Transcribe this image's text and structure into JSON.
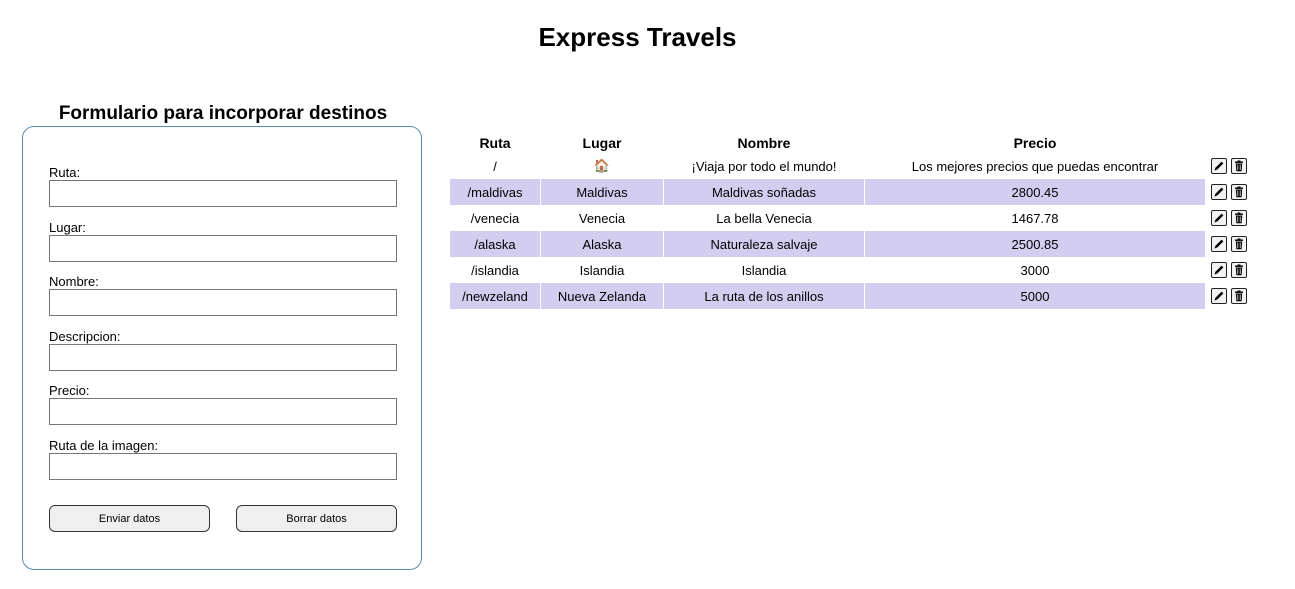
{
  "header": {
    "title": "Express Travels"
  },
  "form": {
    "title": "Formulario para incorporar destinos",
    "fields": [
      {
        "label": "Ruta:",
        "value": ""
      },
      {
        "label": "Lugar:",
        "value": ""
      },
      {
        "label": "Nombre:",
        "value": ""
      },
      {
        "label": "Descripcion:",
        "value": ""
      },
      {
        "label": "Precio:",
        "value": ""
      },
      {
        "label": "Ruta de la imagen:",
        "value": ""
      }
    ],
    "send_label": "Enviar datos",
    "clear_label": "Borrar datos"
  },
  "table": {
    "headers": [
      "Ruta",
      "Lugar",
      "Nombre",
      "Precio"
    ],
    "rows": [
      {
        "ruta": "/",
        "lugar": "🏠",
        "nombre": "¡Viaja por todo el mundo!",
        "precio": "Los mejores precios que puedas encontrar"
      },
      {
        "ruta": "/maldivas",
        "lugar": "Maldivas",
        "nombre": "Maldivas soñadas",
        "precio": "2800.45"
      },
      {
        "ruta": "/venecia",
        "lugar": "Venecia",
        "nombre": "La bella Venecia",
        "precio": "1467.78"
      },
      {
        "ruta": "/alaska",
        "lugar": "Alaska",
        "nombre": "Naturaleza salvaje",
        "precio": "2500.85"
      },
      {
        "ruta": "/islandia",
        "lugar": "Islandia",
        "nombre": "Islandia",
        "precio": "3000"
      },
      {
        "ruta": "/newzeland",
        "lugar": "Nueva Zelanda",
        "nombre": "La ruta de los anillos",
        "precio": "5000"
      }
    ],
    "row_icons": [
      "pencil-icon",
      "trash-icon"
    ]
  },
  "colors": {
    "stripe": "#d3cdef",
    "panel_border": "#5b8db8"
  }
}
